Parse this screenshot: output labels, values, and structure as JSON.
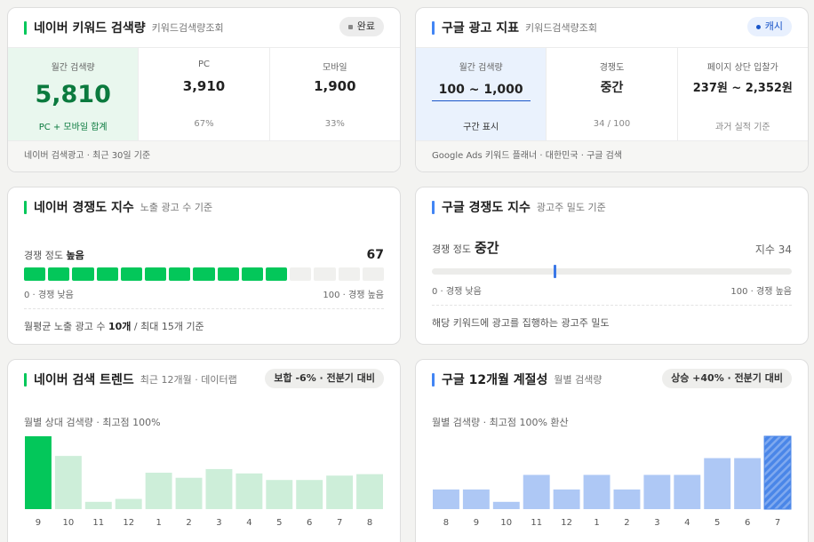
{
  "naver_volume": {
    "title": "네이버 키워드 검색량",
    "subtitle": "키워드검색량조회",
    "badge": "완료",
    "stats": [
      {
        "label": "월간 검색량",
        "value": "5,810",
        "foot": "PC + 모바일 합계"
      },
      {
        "label": "PC",
        "value": "3,910",
        "foot": "67%"
      },
      {
        "label": "모바일",
        "value": "1,900",
        "foot": "33%"
      }
    ],
    "footer": "네이버 검색광고 · 최근 30일 기준"
  },
  "google_ads": {
    "title": "구글 광고 지표",
    "subtitle": "키워드검색량조회",
    "badge": "캐시",
    "stats": [
      {
        "label": "월간 검색량",
        "value": "100 ~ 1,000",
        "foot": "구간 표시"
      },
      {
        "label": "경쟁도",
        "value": "중간",
        "foot": "34 / 100"
      },
      {
        "label": "페이지 상단 입찰가",
        "value": "237원 ~ 2,352원",
        "foot": "과거 실적 기준"
      }
    ],
    "footer": "Google Ads 키워드 플래너 · 대한민국 · 구글 검색"
  },
  "naver_competition": {
    "title": "네이버 경쟁도 지수",
    "subtitle": "노출 광고 수 기준",
    "level_prefix": "경쟁 정도",
    "level": "높음",
    "value": "67",
    "filled_segments": 11,
    "total_segments": 15,
    "scale_low": "0 · 경쟁 낮음",
    "scale_high": "100 · 경쟁 높음",
    "note_pre": "월평균 노출 광고 수 ",
    "note_bold": "10개",
    "note_post": " / 최대 15개 기준"
  },
  "google_competition": {
    "title": "구글 경쟁도 지수",
    "subtitle": "광고주 밀도 기준",
    "level_prefix": "경쟁 정도",
    "level": "중간",
    "index_label": "지수 34",
    "index_value": 34,
    "scale_low": "0 · 경쟁 낮음",
    "scale_high": "100 · 경쟁 높음",
    "note": "해당 키워드에 광고를 집행하는 광고주 밀도"
  },
  "naver_trend": {
    "title": "네이버 검색 트렌드",
    "subtitle": "최근 12개월 · 데이터랩",
    "badge": "보합 -6% · 전분기 대비",
    "caption": "월별 상대 검색량 · 최고점 100%"
  },
  "google_seasonal": {
    "title": "구글 12개월 계절성",
    "subtitle": "월별 검색량",
    "badge": "상승 +40% · 전분기 대비",
    "caption": "월별 검색량 · 최고점 100% 환산"
  },
  "chart_data": [
    {
      "type": "bar",
      "categories": [
        "9",
        "10",
        "11",
        "12",
        "1",
        "2",
        "3",
        "4",
        "5",
        "6",
        "7",
        "8"
      ],
      "values": [
        100,
        73,
        10,
        14,
        50,
        43,
        55,
        49,
        40,
        40,
        46,
        48
      ],
      "ylim": [
        0,
        100
      ],
      "highlight_index": 0,
      "colors": {
        "highlight": "#03c75a",
        "normal": "#cdeed9"
      }
    },
    {
      "type": "bar",
      "categories": [
        "8",
        "9",
        "10",
        "11",
        "12",
        "1",
        "2",
        "3",
        "4",
        "5",
        "6",
        "7"
      ],
      "values": [
        27,
        27,
        10,
        47,
        27,
        47,
        27,
        47,
        47,
        70,
        70,
        100
      ],
      "ylim": [
        0,
        100
      ],
      "highlight_index": 11,
      "colors": {
        "highlight": "#4a86e8",
        "normal": "#aec8f5"
      }
    }
  ]
}
